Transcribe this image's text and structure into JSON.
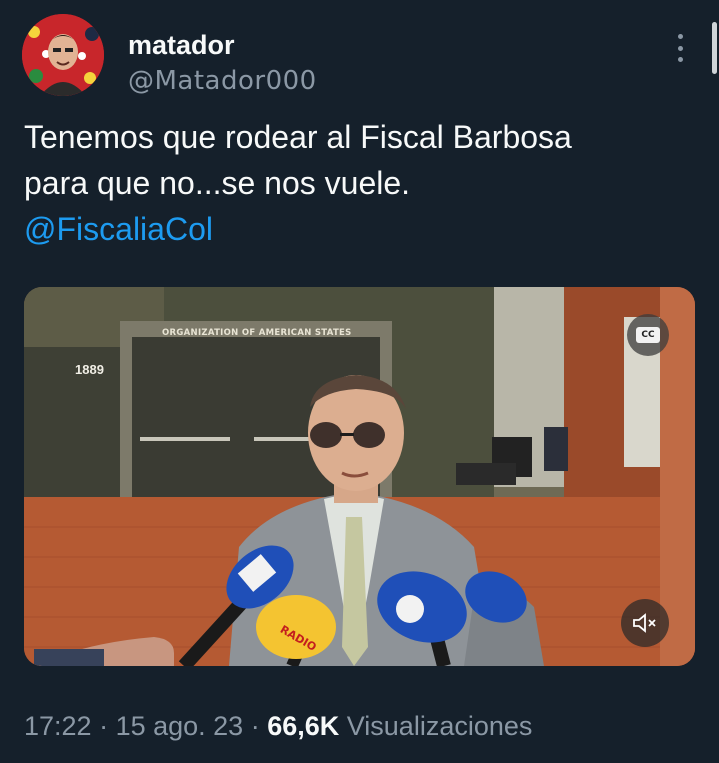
{
  "author": {
    "display_name": "matador",
    "handle": "@Matador000"
  },
  "tweet": {
    "text_line1": "Tenemos que rodear al Fiscal Barbosa",
    "text_line2": "para que no...se nos vuele.",
    "mention": "@FiscaliaCol"
  },
  "media": {
    "sign_text": "ORGANIZATION OF AMERICAN STATES",
    "address_number": "1889",
    "cc_label": "CC",
    "mic_brand_radio": "RADIO"
  },
  "meta": {
    "time": "17:22",
    "sep1": " · ",
    "date": "15 ago. 23",
    "sep2": " · ",
    "views_count": "66,6K",
    "views_label": " Visualizaciones"
  },
  "icons": {
    "more": "more-vertical-icon",
    "cc": "closed-captions-icon",
    "mute": "volume-muted-icon"
  },
  "colors": {
    "background": "#15202b",
    "text": "#f7f9f9",
    "secondary": "#8b98a5",
    "accent": "#1d9bf0"
  }
}
